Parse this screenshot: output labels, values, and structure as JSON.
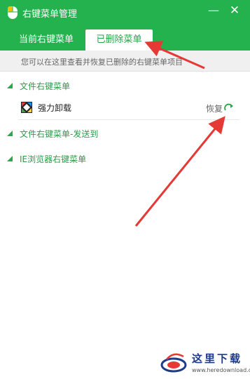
{
  "window": {
    "title": "右键菜单管理",
    "minimize_glyph": "—",
    "close_glyph": "✕"
  },
  "tabs": [
    {
      "label": "当前右键菜单",
      "active": false
    },
    {
      "label": "已删除菜单",
      "active": true
    }
  ],
  "info": "您可以在这里查看并恢复已删除的右键菜单项目",
  "sections": [
    {
      "label": "文件右键菜单",
      "items": [
        {
          "label": "强力卸载",
          "action_label": "恢复",
          "icon": "app-tile-icon",
          "action_icon": "restore-arrow-icon"
        }
      ]
    },
    {
      "label": "文件右键菜单-发送到",
      "items": []
    },
    {
      "label": "IE浏览器右键菜单",
      "items": []
    }
  ],
  "watermark": {
    "text": "这里下载",
    "url": "www.heredownload.com"
  },
  "colors": {
    "brand_green": "#23b24e",
    "section_green": "#2a9d48",
    "annotation_red": "#e53935",
    "watermark_blue": "#1e3a8a"
  }
}
